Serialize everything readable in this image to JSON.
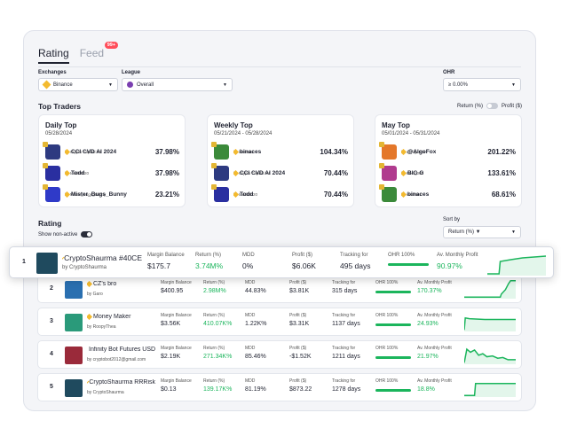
{
  "tabs": [
    {
      "label": "Rating"
    },
    {
      "label": "Feed"
    }
  ],
  "feed_badge": "99+",
  "filters": {
    "exchanges_label": "Exchanges",
    "exchange_value": "Binance",
    "league_label": "League",
    "league_value": "Overall",
    "ohr_label": "OHR",
    "ohr_value": "≥ 0.00%"
  },
  "top_traders": {
    "title": "Top Traders",
    "toggle_left": "Return (%)",
    "toggle_right": "Profit ($)",
    "cards": [
      {
        "title": "Daily Top",
        "range": "05/28/2024",
        "traders": [
          {
            "name": "CCI CVD AI 2024",
            "by": "by Crypto Capital Int.",
            "value": "37.98%",
            "av": "#2d3a80"
          },
          {
            "name": "Todd",
            "by": "by todds2020",
            "value": "37.98%",
            "av": "#2a2fa0"
          },
          {
            "name": "Mister_Bugs_Bunny",
            "by": "by Mister_Bugs_Bunny",
            "value": "23.21%",
            "av": "#2f3ac8"
          }
        ]
      },
      {
        "title": "Weekly Top",
        "range": "05/21/2024 - 05/28/2024",
        "traders": [
          {
            "name": "binaces",
            "by": "by lexastav",
            "value": "104.34%",
            "av": "#3b8a3a"
          },
          {
            "name": "CCI CVD AI 2024",
            "by": "by Crypto Capital Int.",
            "value": "70.44%",
            "av": "#2d3a80"
          },
          {
            "name": "Todd",
            "by": "by todds2020",
            "value": "70.44%",
            "av": "#2a2fa0"
          }
        ]
      },
      {
        "title": "May Top",
        "range": "05/01/2024 - 05/31/2024",
        "traders": [
          {
            "name": "@AlgoFox",
            "by": "by @AlgoFox",
            "value": "201.22%",
            "av": "#e4772a"
          },
          {
            "name": "BIG G",
            "by": "by Pest_007",
            "value": "133.61%",
            "av": "#b03b8e"
          },
          {
            "name": "binaces",
            "by": "by lexastav",
            "value": "68.61%",
            "av": "#3b8a3a"
          }
        ]
      }
    ]
  },
  "rating": {
    "title": "Rating",
    "show_non_active": "Show non-active",
    "sort_label": "Sort by",
    "sort_value": "Return (%) ▼"
  },
  "headers": {
    "margin": "Margin Balance",
    "return": "Return (%)",
    "mdd": "MDD",
    "profit": "Profit ($)",
    "tracking": "Tracking for",
    "ohr": "OHR 100%",
    "monthly": "Av. Monthly Profit"
  },
  "rows": [
    {
      "rank": "1",
      "name": "CryptoShaurma #40CE",
      "by": "by CryptoShaurma",
      "margin": "$175.7",
      "return": "3.74M%",
      "mdd": "0%",
      "profit": "$6.06K",
      "tracking": "495 days",
      "monthly": "90.97%",
      "av": "#1f4a5e",
      "ohr": 1.0
    },
    {
      "rank": "2",
      "name": "CZ's bro",
      "by": "by Garo",
      "margin": "$400.95",
      "return": "2.98M%",
      "mdd": "44.83%",
      "profit": "$3.81K",
      "tracking": "315 days",
      "monthly": "170.37%",
      "av": "#2a6fb0",
      "ohr": 1.0
    },
    {
      "rank": "3",
      "name": "Money Maker",
      "by": "by RoopyThea",
      "margin": "$3.56K",
      "return": "410.07K%",
      "mdd": "1.22K%",
      "profit": "$3.31K",
      "tracking": "1137 days",
      "monthly": "24.93%",
      "av": "#2a9a7a",
      "ohr": 1.0
    },
    {
      "rank": "4",
      "name": "Infinity Bot Futures USD",
      "by": "by cryptobot2012@gmail.com",
      "margin": "$2.19K",
      "return": "271.34K%",
      "mdd": "85.46%",
      "profit": "-$1.52K",
      "tracking": "1211 days",
      "monthly": "21.97%",
      "av": "#9a2a3a",
      "ohr": 1.0
    },
    {
      "rank": "5",
      "name": "CryptoShaurma RRRisk",
      "by": "by CryptoShaurma",
      "margin": "$0.13",
      "return": "139.17K%",
      "mdd": "81.19%",
      "profit": "$873.22",
      "tracking": "1278 days",
      "monthly": "18.8%",
      "av": "#1f4a5e",
      "ohr": 1.0
    }
  ],
  "colors": {
    "green": "#1bb55c",
    "badge": "#ff4d5a",
    "binance": "#f3ba2f"
  }
}
